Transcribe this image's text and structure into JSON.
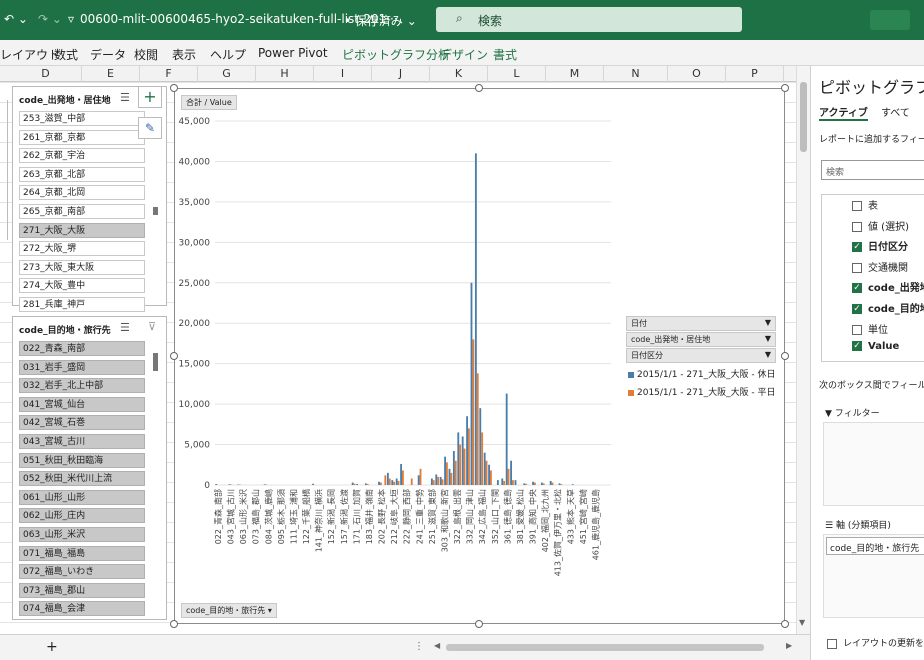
{
  "titlebar": {
    "filename": "00600-mlit-00600465-hyo2-seikatuken-full-list-201···",
    "save_status": "• 保存済み",
    "search_placeholder": "検索"
  },
  "ribbon_tabs": [
    {
      "label": "レイアウト",
      "green": false
    },
    {
      "label": "数式",
      "green": false
    },
    {
      "label": "データ",
      "green": false
    },
    {
      "label": "校閲",
      "green": false
    },
    {
      "label": "表示",
      "green": false
    },
    {
      "label": "ヘルプ",
      "green": false
    },
    {
      "label": "Power Pivot",
      "green": false
    },
    {
      "label": "ピボットグラフ分析",
      "green": true
    },
    {
      "label": "デザイン",
      "green": true
    },
    {
      "label": "書式",
      "green": true
    }
  ],
  "columns": [
    "D",
    "E",
    "F",
    "G",
    "H",
    "I",
    "J",
    "K",
    "L",
    "M",
    "N",
    "O",
    "P"
  ],
  "slicer_origin": {
    "title": "code_出発地・居住地",
    "items": [
      {
        "label": "253_滋賀_中部",
        "selected": false
      },
      {
        "label": "261_京都_京都",
        "selected": false
      },
      {
        "label": "262_京都_宇治",
        "selected": false
      },
      {
        "label": "263_京都_北部",
        "selected": false
      },
      {
        "label": "264_京都_北岡",
        "selected": false
      },
      {
        "label": "265_京都_南部",
        "selected": false
      },
      {
        "label": "271_大阪_大阪",
        "selected": true
      },
      {
        "label": "272_大阪_堺",
        "selected": false
      },
      {
        "label": "273_大阪_東大阪",
        "selected": false
      },
      {
        "label": "274_大阪_豊中",
        "selected": false
      },
      {
        "label": "281_兵庫_神戸",
        "selected": false
      }
    ]
  },
  "slicer_dest": {
    "title": "code_目的地・旅行先",
    "items": [
      {
        "label": "022_青森_南部",
        "selected": true
      },
      {
        "label": "031_岩手_盛岡",
        "selected": true
      },
      {
        "label": "032_岩手_北上中部",
        "selected": true
      },
      {
        "label": "041_宮城_仙台",
        "selected": true
      },
      {
        "label": "042_宮城_石巻",
        "selected": true
      },
      {
        "label": "043_宮城_古川",
        "selected": true
      },
      {
        "label": "051_秋田_秋田臨海",
        "selected": true
      },
      {
        "label": "052_秋田_米代川上流",
        "selected": true
      },
      {
        "label": "061_山形_山形",
        "selected": true
      },
      {
        "label": "062_山形_庄内",
        "selected": true
      },
      {
        "label": "063_山形_米沢",
        "selected": true
      },
      {
        "label": "071_福島_福島",
        "selected": true
      },
      {
        "label": "072_福島_いわき",
        "selected": true
      },
      {
        "label": "073_福島_郡山",
        "selected": true
      },
      {
        "label": "074_福島_会津",
        "selected": true
      }
    ]
  },
  "chart_data": {
    "type": "bar",
    "value_field_button": "合計 / Value",
    "axis_field_button": "code_目的地・旅行先",
    "ylim": [
      0,
      45000
    ],
    "yticks": [
      0,
      5000,
      10000,
      15000,
      20000,
      25000,
      30000,
      35000,
      40000,
      45000
    ],
    "ytick_labels": [
      "0",
      "5,000",
      "10,000",
      "15,000",
      "20,000",
      "25,000",
      "30,000",
      "35,000",
      "40,000",
      "45,000"
    ],
    "category_count": 90,
    "x_tick_labels": [
      "022_青森_南部",
      "043_宮城_古川",
      "063_山形_米沢",
      "073_福島_郡山",
      "084_茨城_鹿嶋",
      "095_栃木_那須",
      "111_埼玉_浦和",
      "122_千葉_船橋",
      "141_神奈川_横浜",
      "152_新潟_長岡",
      "157_新潟_佐渡",
      "171_石川_加賀",
      "183_福井_嶺南",
      "202_長野_松本",
      "212_岐阜_大垣",
      "222_静岡_西部",
      "241_三重_中勢",
      "251_滋賀_東部",
      "303_和歌山_新宮",
      "322_島根_出雲",
      "332_岡山_津山",
      "342_広島_福山",
      "352_山口_下関",
      "361_徳島_徳島",
      "381_愛媛_松山",
      "391_高知_中央",
      "402_福岡_北九州",
      "413_佐賀_伊万里・北松",
      "433_熊本_天草",
      "451_宮崎_宮崎",
      "461_鹿児島_鹿児島"
    ],
    "series": [
      {
        "name": "2015/1/1 - 271_大阪_大阪 - 休日",
        "color": "#4a7ea9",
        "values": [
          120,
          0,
          0,
          90,
          0,
          60,
          0,
          0,
          0,
          0,
          0,
          80,
          0,
          0,
          0,
          0,
          0,
          0,
          0,
          0,
          0,
          0,
          150,
          0,
          0,
          0,
          0,
          0,
          0,
          0,
          0,
          300,
          120,
          0,
          200,
          0,
          0,
          400,
          0,
          1500,
          600,
          800,
          2600,
          0,
          0,
          0,
          1200,
          0,
          0,
          800,
          1300,
          1000,
          3500,
          2000,
          4200,
          6500,
          6000,
          8500,
          25000,
          41000,
          9500,
          4000,
          2500,
          0,
          600,
          800,
          11300,
          3000,
          600,
          0,
          200,
          0,
          400,
          0,
          300,
          0,
          500,
          0,
          200,
          0,
          0,
          100,
          0,
          0,
          0,
          0,
          0,
          0,
          0,
          0
        ]
      },
      {
        "name": "2015/1/1 - 271_大阪_大阪 - 平日",
        "color": "#e07d3a",
        "values": [
          0,
          0,
          0,
          60,
          0,
          40,
          0,
          0,
          0,
          0,
          0,
          50,
          0,
          0,
          0,
          0,
          0,
          0,
          0,
          0,
          0,
          0,
          0,
          0,
          0,
          0,
          0,
          0,
          0,
          0,
          0,
          150,
          0,
          0,
          120,
          0,
          0,
          300,
          1200,
          800,
          400,
          500,
          1800,
          0,
          800,
          0,
          2000,
          0,
          0,
          600,
          1000,
          700,
          2800,
          1500,
          3000,
          5000,
          4500,
          7000,
          18000,
          13800,
          6500,
          3000,
          1800,
          0,
          0,
          500,
          2000,
          600,
          0,
          0,
          150,
          0,
          300,
          0,
          200,
          0,
          300,
          0,
          100,
          0,
          0,
          0,
          0,
          0,
          0,
          0,
          0,
          0,
          0,
          0
        ]
      }
    ],
    "legend_fields": [
      {
        "label": "日付",
        "icon": "▼"
      },
      {
        "label": "code_出発地・居住地",
        "icon": "▼"
      },
      {
        "label": "日付区分",
        "icon": "▼"
      }
    ]
  },
  "pane": {
    "title": "ピボットグラフの",
    "tab_active": "アクティブ",
    "tab_all": "すべて",
    "add_fields_label": "レポートに追加するフィール",
    "search_placeholder": "検索",
    "fields": [
      {
        "label": "表",
        "checked": false,
        "bold": false
      },
      {
        "label": "値 (選択)",
        "checked": false,
        "bold": false
      },
      {
        "label": "日付区分",
        "checked": true,
        "bold": true
      },
      {
        "label": "交通機関",
        "checked": false,
        "bold": false
      },
      {
        "label": "code_出発地",
        "checked": true,
        "bold": true
      },
      {
        "label": "code_目的地",
        "checked": true,
        "bold": true
      },
      {
        "label": "単位",
        "checked": false,
        "bold": false
      },
      {
        "label": "Value",
        "checked": true,
        "bold": true
      }
    ],
    "drag_label": "次のボックス間でフィールド",
    "filter_label": "フィルター",
    "axis_label": "軸 (分類項目)",
    "axis_value": "code_目的地・旅行先",
    "defer_label": "レイアウトの更新を保"
  },
  "bottom": {
    "add_sheet": "+"
  }
}
